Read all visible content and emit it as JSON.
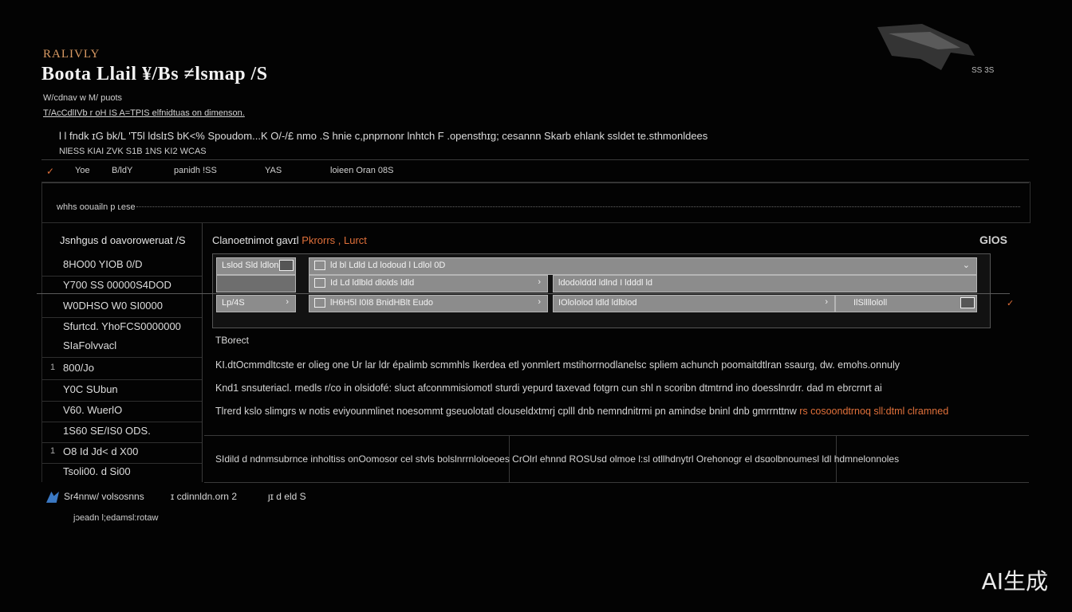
{
  "header": {
    "eyebrow": "RALIVLY",
    "title": "Boota Llail ¥/Bs ≠lsmap /S",
    "subtitle_1": "W/cdnav w M/ puots",
    "subtitle_2": "T/AcCdlIVb r oH IS A=TPIS elfnidtuas on dimenson.",
    "description": "l l fndk ɪG  bk/L 'T5l  ldslɪS  bK<%  Spoudom...K  O/-/£ nmo .S  hnie  c,pnprnonr  lnhtch  F  .opensthɪg;  cesannn Skarb ehlank  ssldet te.sthmonldees",
    "description_2": "NlESS KIAI ZVK S1B  1NS KI2 WCAS",
    "corner_tag": "SS 3S"
  },
  "columns": {
    "check": "✓",
    "c1": "Yoe",
    "c2": "B/ldY",
    "c3": "panidh !SS",
    "c4": "YAS",
    "c5": "loieen Oran 08S"
  },
  "strip": {
    "label": "whhs oouailn p ʟese"
  },
  "sidebar": {
    "heading": "Jsnhgus d oavoroweruat /S",
    "items": [
      {
        "bullet": "",
        "label": "8HO00   YIOB 0/D"
      },
      {
        "bullet": "",
        "label": "Y700 SS   00000S4DOD"
      },
      {
        "bullet": "",
        "label": "W0DHSO   W0 SI0000"
      },
      {
        "bullet": "",
        "label": "Sfurtcd.  YhoFCS0000000"
      },
      {
        "bullet": "",
        "label": "SIaFolvvacl"
      },
      {
        "bullet": "1",
        "label": "800/Jo"
      },
      {
        "bullet": "",
        "label": "Y0C SUbun"
      },
      {
        "bullet": "",
        "label": "V60. WuerlO"
      },
      {
        "bullet": "",
        "label": "1S60 SE/IS0 ODS."
      },
      {
        "bullet": "1",
        "label": "O8 Id Jd< d X00"
      },
      {
        "bullet": "",
        "label": "Tsoli00. d Si00"
      }
    ]
  },
  "main": {
    "title_pre": "Clanoetnimot gavɪl ",
    "title_accent": "Pkrorrs , Lurct",
    "right_badge": "GlOS",
    "rows": {
      "r1a": "Lslod Sld ldlon",
      "r1b": "ld bl Ldld  Ld lodoud l Ldlol  0D",
      "r2b": "Id  Ld ldlbld dlolds ldld",
      "r2c": "ldodolddd ldlnd I ldddl ld",
      "r3a": "Lp/4S",
      "r3b": "lH6H5l  I0I8  BnidHBlt  Eudo",
      "r3c": "IOlololod ldld ldlblod",
      "r3d": "IlSllllololl"
    },
    "section_label": "TBorect",
    "paragraphs": [
      "KI.dtOcmmdltcste   er olieg one Ur lar ldr épalimb scmmhls  Ikerdea  etl  yonmlert mstihorrnodlanelsc spliem achunch  poomaitdtlran ssaurg,  dw. emohs.onnuly",
      "Knd1  snsuteriacl.  rnedls  r/co in olsidofé:  sluct  afconmmisiomotl  sturdi  yepurd   taxevad fotgrn cun  shl n scoribn  dtmtrnd  ino doesslnrdrr.  dad  m  ebrcrnrt ai",
      "Tlrerd kslo slimgrs w notis eviyounmlinet noesommt  gseuolotatl clouseldxtmrj cplll   dnb  nemndnitrmi pn  amindse bninl dnb  gmrrnttnw",
      "rs cosoondtrnoq sll:dtml  clramned"
    ]
  },
  "footer": {
    "text": "SIdild   d  ndnmsubrnce  inholtiss onOomosor cel  stvls  bolslnrrnloloeoes CrOlrl  ehnnd ROSUsd  olmoe  l:sl  otllhdnytrl  Orehonogr  el   dsɑolbnoumesl ldl hdmnelonnoles"
  },
  "bottom": {
    "link_1": "Sr4nnw/  volsosnns",
    "link_2": "ɪ  cdinnldn.orn 2",
    "link_3": "ȷɪ  d   eld S",
    "note": "jɔeadn  l;edamsl:rotaw"
  },
  "watermark": "AI生成",
  "colors": {
    "background": "#030303",
    "accent": "#e0703a",
    "row_fill": "#8c8c8c",
    "link_icon": "#3b79c4"
  }
}
